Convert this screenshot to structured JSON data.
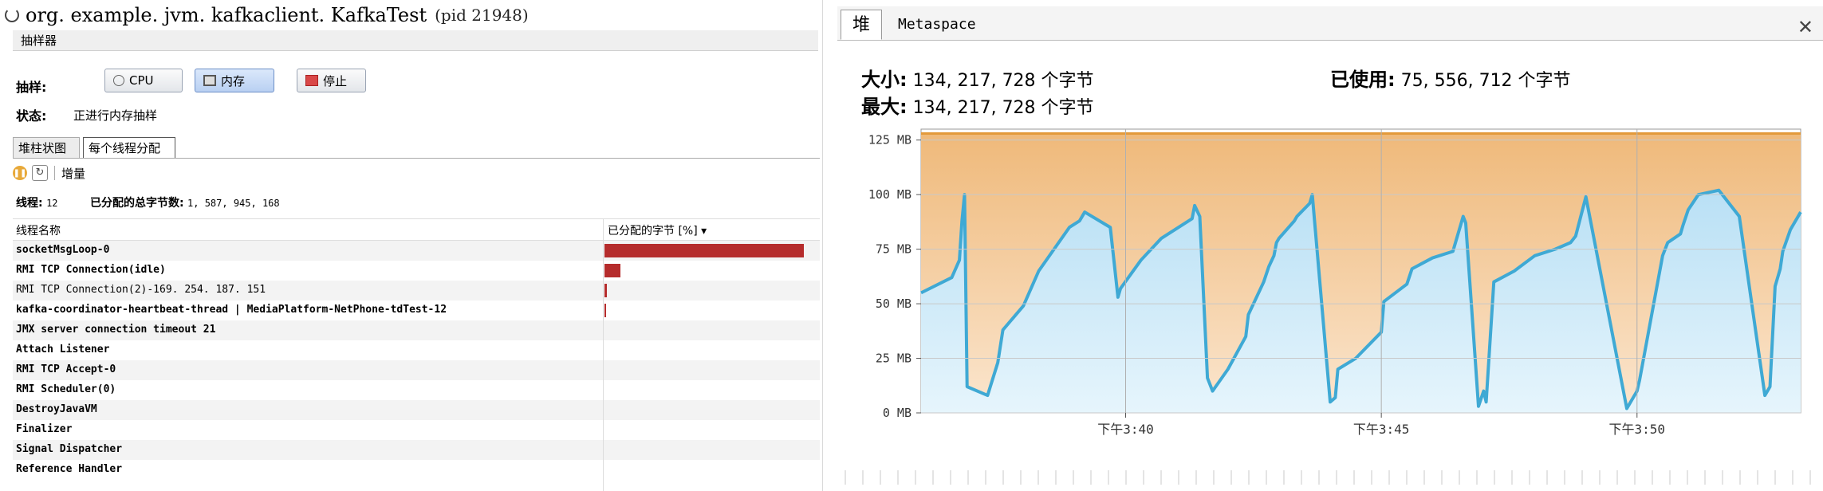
{
  "left": {
    "title": "org. example. jvm. kafkaclient. KafkaTest",
    "pid": "(pid 21948)",
    "sampler_tab": "抽样器",
    "sample_label": "抽样:",
    "status_label": "状态:",
    "status_text": "正进行内存抽样",
    "buttons": {
      "cpu": "CPU",
      "memory": "内存",
      "stop": "停止"
    },
    "tabs": [
      "堆柱状图",
      "每个线程分配"
    ],
    "toolbar_label": "增量",
    "summary": {
      "threads_label": "线程:",
      "threads_value": "12",
      "total_label": "已分配的总字节数:",
      "total_value": "1, 587, 945, 168"
    },
    "table": {
      "col_name": "线程名称",
      "col_bytes": "已分配的字节 [%] ▾",
      "rows": [
        {
          "name": "socketMsgLoop-0",
          "pct": 100
        },
        {
          "name": "RMI TCP Connection(idle)",
          "pct": 8
        },
        {
          "name": "RMI TCP Connection(2)-169. 254. 187. 151",
          "pct": 1
        },
        {
          "name": "kafka-coordinator-heartbeat-thread | MediaPlatform-NetPhone-tdTest-12",
          "pct": 0.5
        },
        {
          "name": "JMX server connection timeout 21",
          "pct": 0
        },
        {
          "name": "Attach Listener",
          "pct": 0
        },
        {
          "name": "RMI TCP Accept-0",
          "pct": 0
        },
        {
          "name": "RMI Scheduler(0)",
          "pct": 0
        },
        {
          "name": "DestroyJavaVM",
          "pct": 0
        },
        {
          "name": "Finalizer",
          "pct": 0
        },
        {
          "name": "Signal Dispatcher",
          "pct": 0
        },
        {
          "name": "Reference Handler",
          "pct": 0
        }
      ]
    }
  },
  "right": {
    "tabs": [
      "堆",
      "Metaspace"
    ],
    "size_label": "大小:",
    "size_value": "134, 217, 728 个字节",
    "max_label": "最大:",
    "max_value": "134, 217, 728 个字节",
    "used_label": "已使用:",
    "used_value": "75, 556, 712 个字节",
    "colors": {
      "size_fill": "#f2c99a",
      "size_line": "#e39a3b",
      "used_fill": "#cfe9f7",
      "used_line": "#3fa9d4"
    }
  },
  "chart_data": {
    "type": "area",
    "ylabel": "",
    "yticks": [
      "0 MB",
      "25 MB",
      "50 MB",
      "75 MB",
      "100 MB",
      "125 MB"
    ],
    "ylim": [
      0,
      130
    ],
    "xticks": [
      "下午3:40",
      "下午3:45",
      "下午3:50"
    ],
    "xtick_minutes": [
      4,
      9,
      14
    ],
    "xlim_minutes": [
      0,
      17.2
    ],
    "grid": true,
    "series": [
      {
        "name": "大小",
        "constant": 128
      },
      {
        "name": "已使用",
        "x": [
          0,
          0.6,
          0.75,
          0.8,
          0.85,
          0.9,
          1.3,
          1.5,
          1.6,
          2.0,
          2.3,
          2.9,
          3.1,
          3.2,
          3.7,
          3.85,
          3.9,
          4.3,
          4.7,
          5.3,
          5.35,
          5.45,
          5.6,
          5.7,
          6.0,
          6.35,
          6.4,
          6.7,
          6.8,
          6.9,
          6.95,
          7.0,
          7.3,
          7.35,
          7.6,
          7.65,
          8.0,
          8.1,
          8.15,
          8.5,
          9.0,
          9.05,
          9.5,
          9.6,
          10.0,
          10.4,
          10.6,
          10.65,
          10.9,
          11.0,
          11.05,
          11.2,
          11.6,
          12.0,
          12.4,
          12.7,
          12.8,
          13.0,
          13.8,
          14.0,
          14.05,
          14.5,
          14.6,
          14.85,
          14.9,
          15.0,
          15.2,
          15.6,
          16.0,
          16.5,
          16.6,
          16.7,
          16.8,
          16.85,
          17.0,
          17.1,
          17.2
        ],
        "y": [
          55,
          62,
          70,
          88,
          100,
          12,
          8,
          23,
          38,
          49,
          65,
          85,
          88,
          92,
          85,
          53,
          57,
          70,
          80,
          89,
          95,
          90,
          16,
          10,
          20,
          35,
          45,
          60,
          67,
          72,
          78,
          80,
          88,
          90,
          96,
          100,
          5,
          7,
          20,
          25,
          37,
          51,
          59,
          66,
          71,
          74,
          90,
          87,
          3,
          10,
          5,
          60,
          65,
          72,
          75,
          78,
          81,
          99,
          2,
          10,
          15,
          72,
          78,
          82,
          86,
          93,
          100,
          102,
          90,
          8,
          12,
          58,
          66,
          74,
          84,
          88,
          92
        ]
      }
    ]
  }
}
